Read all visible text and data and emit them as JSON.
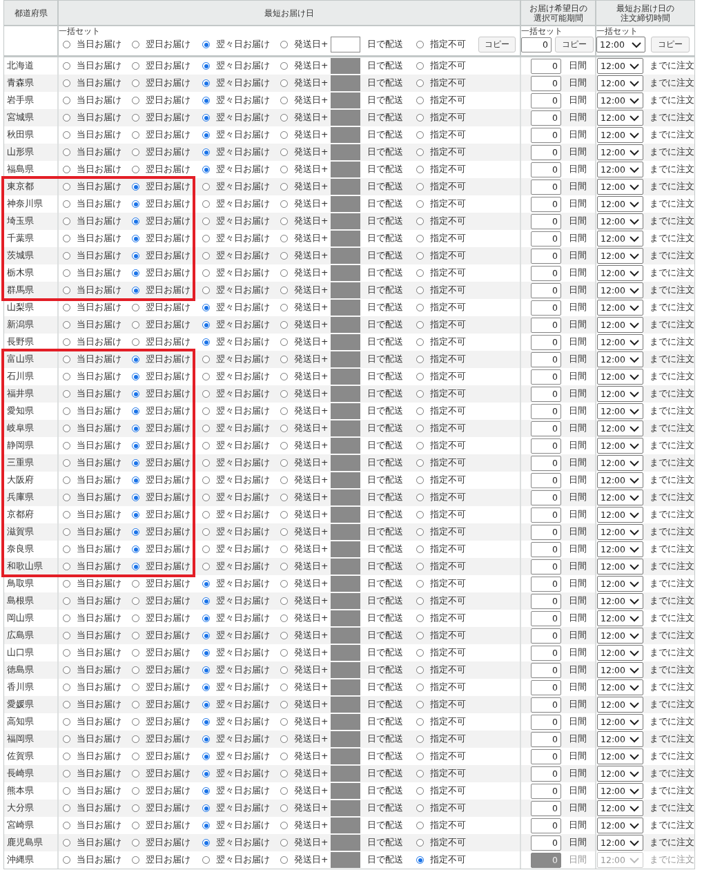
{
  "headers": {
    "prefecture": [
      "都道府県"
    ],
    "earliest": [
      "最短お届け日"
    ],
    "period": [
      "お届け希望日の",
      "選択可能期間"
    ],
    "cutoff": [
      "最短お届け日の",
      "注文締切時間"
    ]
  },
  "bulk": {
    "label": "一括セット",
    "options": [
      {
        "kind": "plain",
        "label": "当日お届け",
        "selected": false
      },
      {
        "kind": "plain",
        "label": "翌日お届け",
        "selected": false
      },
      {
        "kind": "plain",
        "label": "翌々日お届け",
        "selected": true
      },
      {
        "kind": "days",
        "label": "発送日+",
        "suffix": "日で配送",
        "selected": false
      },
      {
        "kind": "plain",
        "label": "指定不可",
        "selected": false
      }
    ],
    "copy": "コピー"
  },
  "period_bulk": {
    "label": "一括セット",
    "value": "0",
    "copy": "コピー"
  },
  "cutoff_bulk": {
    "label": "一括セット",
    "value": "12:00",
    "copy": "コピー"
  },
  "rows": [
    {
      "name": "北海道",
      "marked": false,
      "disabled": false,
      "options": [
        {
          "kind": "plain",
          "label": "当日お届け",
          "selected": false
        },
        {
          "kind": "plain",
          "label": "翌日お届け",
          "selected": false
        },
        {
          "kind": "plain",
          "label": "翌々日お届け",
          "selected": true
        },
        {
          "kind": "days",
          "label": "発送日+",
          "suffix": "日で配送",
          "selected": false
        },
        {
          "kind": "plain",
          "label": "指定不可",
          "selected": false
        }
      ],
      "period": "0",
      "period_unit": "日間",
      "cutoff": "12:00",
      "cutoff_suffix": "までに注文"
    },
    {
      "name": "青森県",
      "marked": false,
      "disabled": false,
      "options": [
        {
          "kind": "plain",
          "label": "当日お届け",
          "selected": false
        },
        {
          "kind": "plain",
          "label": "翌日お届け",
          "selected": false
        },
        {
          "kind": "plain",
          "label": "翌々日お届け",
          "selected": true
        },
        {
          "kind": "days",
          "label": "発送日+",
          "suffix": "日で配送",
          "selected": false
        },
        {
          "kind": "plain",
          "label": "指定不可",
          "selected": false
        }
      ],
      "period": "0",
      "period_unit": "日間",
      "cutoff": "12:00",
      "cutoff_suffix": "までに注文"
    },
    {
      "name": "岩手県",
      "marked": false,
      "disabled": false,
      "options": [
        {
          "kind": "plain",
          "label": "当日お届け",
          "selected": false
        },
        {
          "kind": "plain",
          "label": "翌日お届け",
          "selected": false
        },
        {
          "kind": "plain",
          "label": "翌々日お届け",
          "selected": true
        },
        {
          "kind": "days",
          "label": "発送日+",
          "suffix": "日で配送",
          "selected": false
        },
        {
          "kind": "plain",
          "label": "指定不可",
          "selected": false
        }
      ],
      "period": "0",
      "period_unit": "日間",
      "cutoff": "12:00",
      "cutoff_suffix": "までに注文"
    },
    {
      "name": "宮城県",
      "marked": false,
      "disabled": false,
      "options": [
        {
          "kind": "plain",
          "label": "当日お届け",
          "selected": false
        },
        {
          "kind": "plain",
          "label": "翌日お届け",
          "selected": false
        },
        {
          "kind": "plain",
          "label": "翌々日お届け",
          "selected": true
        },
        {
          "kind": "days",
          "label": "発送日+",
          "suffix": "日で配送",
          "selected": false
        },
        {
          "kind": "plain",
          "label": "指定不可",
          "selected": false
        }
      ],
      "period": "0",
      "period_unit": "日間",
      "cutoff": "12:00",
      "cutoff_suffix": "までに注文"
    },
    {
      "name": "秋田県",
      "marked": false,
      "disabled": false,
      "options": [
        {
          "kind": "plain",
          "label": "当日お届け",
          "selected": false
        },
        {
          "kind": "plain",
          "label": "翌日お届け",
          "selected": false
        },
        {
          "kind": "plain",
          "label": "翌々日お届け",
          "selected": true
        },
        {
          "kind": "days",
          "label": "発送日+",
          "suffix": "日で配送",
          "selected": false
        },
        {
          "kind": "plain",
          "label": "指定不可",
          "selected": false
        }
      ],
      "period": "0",
      "period_unit": "日間",
      "cutoff": "12:00",
      "cutoff_suffix": "までに注文"
    },
    {
      "name": "山形県",
      "marked": false,
      "disabled": false,
      "options": [
        {
          "kind": "plain",
          "label": "当日お届け",
          "selected": false
        },
        {
          "kind": "plain",
          "label": "翌日お届け",
          "selected": false
        },
        {
          "kind": "plain",
          "label": "翌々日お届け",
          "selected": true
        },
        {
          "kind": "days",
          "label": "発送日+",
          "suffix": "日で配送",
          "selected": false
        },
        {
          "kind": "plain",
          "label": "指定不可",
          "selected": false
        }
      ],
      "period": "0",
      "period_unit": "日間",
      "cutoff": "12:00",
      "cutoff_suffix": "までに注文"
    },
    {
      "name": "福島県",
      "marked": false,
      "disabled": false,
      "options": [
        {
          "kind": "plain",
          "label": "当日お届け",
          "selected": false
        },
        {
          "kind": "plain",
          "label": "翌日お届け",
          "selected": false
        },
        {
          "kind": "plain",
          "label": "翌々日お届け",
          "selected": true
        },
        {
          "kind": "days",
          "label": "発送日+",
          "suffix": "日で配送",
          "selected": false
        },
        {
          "kind": "plain",
          "label": "指定不可",
          "selected": false
        }
      ],
      "period": "0",
      "period_unit": "日間",
      "cutoff": "12:00",
      "cutoff_suffix": "までに注文"
    },
    {
      "name": "東京都",
      "marked": true,
      "disabled": false,
      "options": [
        {
          "kind": "plain",
          "label": "当日お届け",
          "selected": false
        },
        {
          "kind": "plain",
          "label": "翌日お届け",
          "selected": true
        },
        {
          "kind": "plain",
          "label": "翌々日お届け",
          "selected": false
        },
        {
          "kind": "days",
          "label": "発送日+",
          "suffix": "日で配送",
          "selected": false
        },
        {
          "kind": "plain",
          "label": "指定不可",
          "selected": false
        }
      ],
      "period": "0",
      "period_unit": "日間",
      "cutoff": "12:00",
      "cutoff_suffix": "までに注文"
    },
    {
      "name": "神奈川県",
      "marked": true,
      "disabled": false,
      "options": [
        {
          "kind": "plain",
          "label": "当日お届け",
          "selected": false
        },
        {
          "kind": "plain",
          "label": "翌日お届け",
          "selected": true
        },
        {
          "kind": "plain",
          "label": "翌々日お届け",
          "selected": false
        },
        {
          "kind": "days",
          "label": "発送日+",
          "suffix": "日で配送",
          "selected": false
        },
        {
          "kind": "plain",
          "label": "指定不可",
          "selected": false
        }
      ],
      "period": "0",
      "period_unit": "日間",
      "cutoff": "12:00",
      "cutoff_suffix": "までに注文"
    },
    {
      "name": "埼玉県",
      "marked": true,
      "disabled": false,
      "options": [
        {
          "kind": "plain",
          "label": "当日お届け",
          "selected": false
        },
        {
          "kind": "plain",
          "label": "翌日お届け",
          "selected": true
        },
        {
          "kind": "plain",
          "label": "翌々日お届け",
          "selected": false
        },
        {
          "kind": "days",
          "label": "発送日+",
          "suffix": "日で配送",
          "selected": false
        },
        {
          "kind": "plain",
          "label": "指定不可",
          "selected": false
        }
      ],
      "period": "0",
      "period_unit": "日間",
      "cutoff": "12:00",
      "cutoff_suffix": "までに注文"
    },
    {
      "name": "千葉県",
      "marked": true,
      "disabled": false,
      "options": [
        {
          "kind": "plain",
          "label": "当日お届け",
          "selected": false
        },
        {
          "kind": "plain",
          "label": "翌日お届け",
          "selected": true
        },
        {
          "kind": "plain",
          "label": "翌々日お届け",
          "selected": false
        },
        {
          "kind": "days",
          "label": "発送日+",
          "suffix": "日で配送",
          "selected": false
        },
        {
          "kind": "plain",
          "label": "指定不可",
          "selected": false
        }
      ],
      "period": "0",
      "period_unit": "日間",
      "cutoff": "12:00",
      "cutoff_suffix": "までに注文"
    },
    {
      "name": "茨城県",
      "marked": true,
      "disabled": false,
      "options": [
        {
          "kind": "plain",
          "label": "当日お届け",
          "selected": false
        },
        {
          "kind": "plain",
          "label": "翌日お届け",
          "selected": true
        },
        {
          "kind": "plain",
          "label": "翌々日お届け",
          "selected": false
        },
        {
          "kind": "days",
          "label": "発送日+",
          "suffix": "日で配送",
          "selected": false
        },
        {
          "kind": "plain",
          "label": "指定不可",
          "selected": false
        }
      ],
      "period": "0",
      "period_unit": "日間",
      "cutoff": "12:00",
      "cutoff_suffix": "までに注文"
    },
    {
      "name": "栃木県",
      "marked": true,
      "disabled": false,
      "options": [
        {
          "kind": "plain",
          "label": "当日お届け",
          "selected": false
        },
        {
          "kind": "plain",
          "label": "翌日お届け",
          "selected": true
        },
        {
          "kind": "plain",
          "label": "翌々日お届け",
          "selected": false
        },
        {
          "kind": "days",
          "label": "発送日+",
          "suffix": "日で配送",
          "selected": false
        },
        {
          "kind": "plain",
          "label": "指定不可",
          "selected": false
        }
      ],
      "period": "0",
      "period_unit": "日間",
      "cutoff": "12:00",
      "cutoff_suffix": "までに注文"
    },
    {
      "name": "群馬県",
      "marked": true,
      "disabled": false,
      "options": [
        {
          "kind": "plain",
          "label": "当日お届け",
          "selected": false
        },
        {
          "kind": "plain",
          "label": "翌日お届け",
          "selected": true
        },
        {
          "kind": "plain",
          "label": "翌々日お届け",
          "selected": false
        },
        {
          "kind": "days",
          "label": "発送日+",
          "suffix": "日で配送",
          "selected": false
        },
        {
          "kind": "plain",
          "label": "指定不可",
          "selected": false
        }
      ],
      "period": "0",
      "period_unit": "日間",
      "cutoff": "12:00",
      "cutoff_suffix": "までに注文"
    },
    {
      "name": "山梨県",
      "marked": false,
      "disabled": false,
      "options": [
        {
          "kind": "plain",
          "label": "当日お届け",
          "selected": false
        },
        {
          "kind": "plain",
          "label": "翌日お届け",
          "selected": false
        },
        {
          "kind": "plain",
          "label": "翌々日お届け",
          "selected": true
        },
        {
          "kind": "days",
          "label": "発送日+",
          "suffix": "日で配送",
          "selected": false
        },
        {
          "kind": "plain",
          "label": "指定不可",
          "selected": false
        }
      ],
      "period": "0",
      "period_unit": "日間",
      "cutoff": "12:00",
      "cutoff_suffix": "までに注文"
    },
    {
      "name": "新潟県",
      "marked": false,
      "disabled": false,
      "options": [
        {
          "kind": "plain",
          "label": "当日お届け",
          "selected": false
        },
        {
          "kind": "plain",
          "label": "翌日お届け",
          "selected": false
        },
        {
          "kind": "plain",
          "label": "翌々日お届け",
          "selected": true
        },
        {
          "kind": "days",
          "label": "発送日+",
          "suffix": "日で配送",
          "selected": false
        },
        {
          "kind": "plain",
          "label": "指定不可",
          "selected": false
        }
      ],
      "period": "0",
      "period_unit": "日間",
      "cutoff": "12:00",
      "cutoff_suffix": "までに注文"
    },
    {
      "name": "長野県",
      "marked": false,
      "disabled": false,
      "options": [
        {
          "kind": "plain",
          "label": "当日お届け",
          "selected": false
        },
        {
          "kind": "plain",
          "label": "翌日お届け",
          "selected": false
        },
        {
          "kind": "plain",
          "label": "翌々日お届け",
          "selected": true
        },
        {
          "kind": "days",
          "label": "発送日+",
          "suffix": "日で配送",
          "selected": false
        },
        {
          "kind": "plain",
          "label": "指定不可",
          "selected": false
        }
      ],
      "period": "0",
      "period_unit": "日間",
      "cutoff": "12:00",
      "cutoff_suffix": "までに注文"
    },
    {
      "name": "富山県",
      "marked": true,
      "disabled": false,
      "options": [
        {
          "kind": "plain",
          "label": "当日お届け",
          "selected": false
        },
        {
          "kind": "plain",
          "label": "翌日お届け",
          "selected": true
        },
        {
          "kind": "plain",
          "label": "翌々日お届け",
          "selected": false
        },
        {
          "kind": "days",
          "label": "発送日+",
          "suffix": "日で配送",
          "selected": false
        },
        {
          "kind": "plain",
          "label": "指定不可",
          "selected": false
        }
      ],
      "period": "0",
      "period_unit": "日間",
      "cutoff": "12:00",
      "cutoff_suffix": "までに注文"
    },
    {
      "name": "石川県",
      "marked": true,
      "disabled": false,
      "options": [
        {
          "kind": "plain",
          "label": "当日お届け",
          "selected": false
        },
        {
          "kind": "plain",
          "label": "翌日お届け",
          "selected": true
        },
        {
          "kind": "plain",
          "label": "翌々日お届け",
          "selected": false
        },
        {
          "kind": "days",
          "label": "発送日+",
          "suffix": "日で配送",
          "selected": false
        },
        {
          "kind": "plain",
          "label": "指定不可",
          "selected": false
        }
      ],
      "period": "0",
      "period_unit": "日間",
      "cutoff": "12:00",
      "cutoff_suffix": "までに注文"
    },
    {
      "name": "福井県",
      "marked": true,
      "disabled": false,
      "options": [
        {
          "kind": "plain",
          "label": "当日お届け",
          "selected": false
        },
        {
          "kind": "plain",
          "label": "翌日お届け",
          "selected": true
        },
        {
          "kind": "plain",
          "label": "翌々日お届け",
          "selected": false
        },
        {
          "kind": "days",
          "label": "発送日+",
          "suffix": "日で配送",
          "selected": false
        },
        {
          "kind": "plain",
          "label": "指定不可",
          "selected": false
        }
      ],
      "period": "0",
      "period_unit": "日間",
      "cutoff": "12:00",
      "cutoff_suffix": "までに注文"
    },
    {
      "name": "愛知県",
      "marked": true,
      "disabled": false,
      "options": [
        {
          "kind": "plain",
          "label": "当日お届け",
          "selected": false
        },
        {
          "kind": "plain",
          "label": "翌日お届け",
          "selected": true
        },
        {
          "kind": "plain",
          "label": "翌々日お届け",
          "selected": false
        },
        {
          "kind": "days",
          "label": "発送日+",
          "suffix": "日で配送",
          "selected": false
        },
        {
          "kind": "plain",
          "label": "指定不可",
          "selected": false
        }
      ],
      "period": "0",
      "period_unit": "日間",
      "cutoff": "12:00",
      "cutoff_suffix": "までに注文"
    },
    {
      "name": "岐阜県",
      "marked": true,
      "disabled": false,
      "options": [
        {
          "kind": "plain",
          "label": "当日お届け",
          "selected": false
        },
        {
          "kind": "plain",
          "label": "翌日お届け",
          "selected": true
        },
        {
          "kind": "plain",
          "label": "翌々日お届け",
          "selected": false
        },
        {
          "kind": "days",
          "label": "発送日+",
          "suffix": "日で配送",
          "selected": false
        },
        {
          "kind": "plain",
          "label": "指定不可",
          "selected": false
        }
      ],
      "period": "0",
      "period_unit": "日間",
      "cutoff": "12:00",
      "cutoff_suffix": "までに注文"
    },
    {
      "name": "静岡県",
      "marked": true,
      "disabled": false,
      "options": [
        {
          "kind": "plain",
          "label": "当日お届け",
          "selected": false
        },
        {
          "kind": "plain",
          "label": "翌日お届け",
          "selected": true
        },
        {
          "kind": "plain",
          "label": "翌々日お届け",
          "selected": false
        },
        {
          "kind": "days",
          "label": "発送日+",
          "suffix": "日で配送",
          "selected": false
        },
        {
          "kind": "plain",
          "label": "指定不可",
          "selected": false
        }
      ],
      "period": "0",
      "period_unit": "日間",
      "cutoff": "12:00",
      "cutoff_suffix": "までに注文"
    },
    {
      "name": "三重県",
      "marked": true,
      "disabled": false,
      "options": [
        {
          "kind": "plain",
          "label": "当日お届け",
          "selected": false
        },
        {
          "kind": "plain",
          "label": "翌日お届け",
          "selected": true
        },
        {
          "kind": "plain",
          "label": "翌々日お届け",
          "selected": false
        },
        {
          "kind": "days",
          "label": "発送日+",
          "suffix": "日で配送",
          "selected": false
        },
        {
          "kind": "plain",
          "label": "指定不可",
          "selected": false
        }
      ],
      "period": "0",
      "period_unit": "日間",
      "cutoff": "12:00",
      "cutoff_suffix": "までに注文"
    },
    {
      "name": "大阪府",
      "marked": true,
      "disabled": false,
      "options": [
        {
          "kind": "plain",
          "label": "当日お届け",
          "selected": false
        },
        {
          "kind": "plain",
          "label": "翌日お届け",
          "selected": true
        },
        {
          "kind": "plain",
          "label": "翌々日お届け",
          "selected": false
        },
        {
          "kind": "days",
          "label": "発送日+",
          "suffix": "日で配送",
          "selected": false
        },
        {
          "kind": "plain",
          "label": "指定不可",
          "selected": false
        }
      ],
      "period": "0",
      "period_unit": "日間",
      "cutoff": "12:00",
      "cutoff_suffix": "までに注文"
    },
    {
      "name": "兵庫県",
      "marked": true,
      "disabled": false,
      "options": [
        {
          "kind": "plain",
          "label": "当日お届け",
          "selected": false
        },
        {
          "kind": "plain",
          "label": "翌日お届け",
          "selected": true
        },
        {
          "kind": "plain",
          "label": "翌々日お届け",
          "selected": false
        },
        {
          "kind": "days",
          "label": "発送日+",
          "suffix": "日で配送",
          "selected": false
        },
        {
          "kind": "plain",
          "label": "指定不可",
          "selected": false
        }
      ],
      "period": "0",
      "period_unit": "日間",
      "cutoff": "12:00",
      "cutoff_suffix": "までに注文"
    },
    {
      "name": "京都府",
      "marked": true,
      "disabled": false,
      "options": [
        {
          "kind": "plain",
          "label": "当日お届け",
          "selected": false
        },
        {
          "kind": "plain",
          "label": "翌日お届け",
          "selected": true
        },
        {
          "kind": "plain",
          "label": "翌々日お届け",
          "selected": false
        },
        {
          "kind": "days",
          "label": "発送日+",
          "suffix": "日で配送",
          "selected": false
        },
        {
          "kind": "plain",
          "label": "指定不可",
          "selected": false
        }
      ],
      "period": "0",
      "period_unit": "日間",
      "cutoff": "12:00",
      "cutoff_suffix": "までに注文"
    },
    {
      "name": "滋賀県",
      "marked": true,
      "disabled": false,
      "options": [
        {
          "kind": "plain",
          "label": "当日お届け",
          "selected": false
        },
        {
          "kind": "plain",
          "label": "翌日お届け",
          "selected": true
        },
        {
          "kind": "plain",
          "label": "翌々日お届け",
          "selected": false
        },
        {
          "kind": "days",
          "label": "発送日+",
          "suffix": "日で配送",
          "selected": false
        },
        {
          "kind": "plain",
          "label": "指定不可",
          "selected": false
        }
      ],
      "period": "0",
      "period_unit": "日間",
      "cutoff": "12:00",
      "cutoff_suffix": "までに注文"
    },
    {
      "name": "奈良県",
      "marked": true,
      "disabled": false,
      "options": [
        {
          "kind": "plain",
          "label": "当日お届け",
          "selected": false
        },
        {
          "kind": "plain",
          "label": "翌日お届け",
          "selected": true
        },
        {
          "kind": "plain",
          "label": "翌々日お届け",
          "selected": false
        },
        {
          "kind": "days",
          "label": "発送日+",
          "suffix": "日で配送",
          "selected": false
        },
        {
          "kind": "plain",
          "label": "指定不可",
          "selected": false
        }
      ],
      "period": "0",
      "period_unit": "日間",
      "cutoff": "12:00",
      "cutoff_suffix": "までに注文"
    },
    {
      "name": "和歌山県",
      "marked": true,
      "disabled": false,
      "options": [
        {
          "kind": "plain",
          "label": "当日お届け",
          "selected": false
        },
        {
          "kind": "plain",
          "label": "翌日お届け",
          "selected": true
        },
        {
          "kind": "plain",
          "label": "翌々日お届け",
          "selected": false
        },
        {
          "kind": "days",
          "label": "発送日+",
          "suffix": "日で配送",
          "selected": false
        },
        {
          "kind": "plain",
          "label": "指定不可",
          "selected": false
        }
      ],
      "period": "0",
      "period_unit": "日間",
      "cutoff": "12:00",
      "cutoff_suffix": "までに注文"
    },
    {
      "name": "鳥取県",
      "marked": false,
      "disabled": false,
      "options": [
        {
          "kind": "plain",
          "label": "当日お届け",
          "selected": false
        },
        {
          "kind": "plain",
          "label": "翌日お届け",
          "selected": false
        },
        {
          "kind": "plain",
          "label": "翌々日お届け",
          "selected": true
        },
        {
          "kind": "days",
          "label": "発送日+",
          "suffix": "日で配送",
          "selected": false
        },
        {
          "kind": "plain",
          "label": "指定不可",
          "selected": false
        }
      ],
      "period": "0",
      "period_unit": "日間",
      "cutoff": "12:00",
      "cutoff_suffix": "までに注文"
    },
    {
      "name": "島根県",
      "marked": false,
      "disabled": false,
      "options": [
        {
          "kind": "plain",
          "label": "当日お届け",
          "selected": false
        },
        {
          "kind": "plain",
          "label": "翌日お届け",
          "selected": false
        },
        {
          "kind": "plain",
          "label": "翌々日お届け",
          "selected": true
        },
        {
          "kind": "days",
          "label": "発送日+",
          "suffix": "日で配送",
          "selected": false
        },
        {
          "kind": "plain",
          "label": "指定不可",
          "selected": false
        }
      ],
      "period": "0",
      "period_unit": "日間",
      "cutoff": "12:00",
      "cutoff_suffix": "までに注文"
    },
    {
      "name": "岡山県",
      "marked": false,
      "disabled": false,
      "options": [
        {
          "kind": "plain",
          "label": "当日お届け",
          "selected": false
        },
        {
          "kind": "plain",
          "label": "翌日お届け",
          "selected": false
        },
        {
          "kind": "plain",
          "label": "翌々日お届け",
          "selected": true
        },
        {
          "kind": "days",
          "label": "発送日+",
          "suffix": "日で配送",
          "selected": false
        },
        {
          "kind": "plain",
          "label": "指定不可",
          "selected": false
        }
      ],
      "period": "0",
      "period_unit": "日間",
      "cutoff": "12:00",
      "cutoff_suffix": "までに注文"
    },
    {
      "name": "広島県",
      "marked": false,
      "disabled": false,
      "options": [
        {
          "kind": "plain",
          "label": "当日お届け",
          "selected": false
        },
        {
          "kind": "plain",
          "label": "翌日お届け",
          "selected": false
        },
        {
          "kind": "plain",
          "label": "翌々日お届け",
          "selected": true
        },
        {
          "kind": "days",
          "label": "発送日+",
          "suffix": "日で配送",
          "selected": false
        },
        {
          "kind": "plain",
          "label": "指定不可",
          "selected": false
        }
      ],
      "period": "0",
      "period_unit": "日間",
      "cutoff": "12:00",
      "cutoff_suffix": "までに注文"
    },
    {
      "name": "山口県",
      "marked": false,
      "disabled": false,
      "options": [
        {
          "kind": "plain",
          "label": "当日お届け",
          "selected": false
        },
        {
          "kind": "plain",
          "label": "翌日お届け",
          "selected": false
        },
        {
          "kind": "plain",
          "label": "翌々日お届け",
          "selected": true
        },
        {
          "kind": "days",
          "label": "発送日+",
          "suffix": "日で配送",
          "selected": false
        },
        {
          "kind": "plain",
          "label": "指定不可",
          "selected": false
        }
      ],
      "period": "0",
      "period_unit": "日間",
      "cutoff": "12:00",
      "cutoff_suffix": "までに注文"
    },
    {
      "name": "徳島県",
      "marked": false,
      "disabled": false,
      "options": [
        {
          "kind": "plain",
          "label": "当日お届け",
          "selected": false
        },
        {
          "kind": "plain",
          "label": "翌日お届け",
          "selected": false
        },
        {
          "kind": "plain",
          "label": "翌々日お届け",
          "selected": true
        },
        {
          "kind": "days",
          "label": "発送日+",
          "suffix": "日で配送",
          "selected": false
        },
        {
          "kind": "plain",
          "label": "指定不可",
          "selected": false
        }
      ],
      "period": "0",
      "period_unit": "日間",
      "cutoff": "12:00",
      "cutoff_suffix": "までに注文"
    },
    {
      "name": "香川県",
      "marked": false,
      "disabled": false,
      "options": [
        {
          "kind": "plain",
          "label": "当日お届け",
          "selected": false
        },
        {
          "kind": "plain",
          "label": "翌日お届け",
          "selected": false
        },
        {
          "kind": "plain",
          "label": "翌々日お届け",
          "selected": true
        },
        {
          "kind": "days",
          "label": "発送日+",
          "suffix": "日で配送",
          "selected": false
        },
        {
          "kind": "plain",
          "label": "指定不可",
          "selected": false
        }
      ],
      "period": "0",
      "period_unit": "日間",
      "cutoff": "12:00",
      "cutoff_suffix": "までに注文"
    },
    {
      "name": "愛媛県",
      "marked": false,
      "disabled": false,
      "options": [
        {
          "kind": "plain",
          "label": "当日お届け",
          "selected": false
        },
        {
          "kind": "plain",
          "label": "翌日お届け",
          "selected": false
        },
        {
          "kind": "plain",
          "label": "翌々日お届け",
          "selected": true
        },
        {
          "kind": "days",
          "label": "発送日+",
          "suffix": "日で配送",
          "selected": false
        },
        {
          "kind": "plain",
          "label": "指定不可",
          "selected": false
        }
      ],
      "period": "0",
      "period_unit": "日間",
      "cutoff": "12:00",
      "cutoff_suffix": "までに注文"
    },
    {
      "name": "高知県",
      "marked": false,
      "disabled": false,
      "options": [
        {
          "kind": "plain",
          "label": "当日お届け",
          "selected": false
        },
        {
          "kind": "plain",
          "label": "翌日お届け",
          "selected": false
        },
        {
          "kind": "plain",
          "label": "翌々日お届け",
          "selected": true
        },
        {
          "kind": "days",
          "label": "発送日+",
          "suffix": "日で配送",
          "selected": false
        },
        {
          "kind": "plain",
          "label": "指定不可",
          "selected": false
        }
      ],
      "period": "0",
      "period_unit": "日間",
      "cutoff": "12:00",
      "cutoff_suffix": "までに注文"
    },
    {
      "name": "福岡県",
      "marked": false,
      "disabled": false,
      "options": [
        {
          "kind": "plain",
          "label": "当日お届け",
          "selected": false
        },
        {
          "kind": "plain",
          "label": "翌日お届け",
          "selected": false
        },
        {
          "kind": "plain",
          "label": "翌々日お届け",
          "selected": true
        },
        {
          "kind": "days",
          "label": "発送日+",
          "suffix": "日で配送",
          "selected": false
        },
        {
          "kind": "plain",
          "label": "指定不可",
          "selected": false
        }
      ],
      "period": "0",
      "period_unit": "日間",
      "cutoff": "12:00",
      "cutoff_suffix": "までに注文"
    },
    {
      "name": "佐賀県",
      "marked": false,
      "disabled": false,
      "options": [
        {
          "kind": "plain",
          "label": "当日お届け",
          "selected": false
        },
        {
          "kind": "plain",
          "label": "翌日お届け",
          "selected": false
        },
        {
          "kind": "plain",
          "label": "翌々日お届け",
          "selected": true
        },
        {
          "kind": "days",
          "label": "発送日+",
          "suffix": "日で配送",
          "selected": false
        },
        {
          "kind": "plain",
          "label": "指定不可",
          "selected": false
        }
      ],
      "period": "0",
      "period_unit": "日間",
      "cutoff": "12:00",
      "cutoff_suffix": "までに注文"
    },
    {
      "name": "長崎県",
      "marked": false,
      "disabled": false,
      "options": [
        {
          "kind": "plain",
          "label": "当日お届け",
          "selected": false
        },
        {
          "kind": "plain",
          "label": "翌日お届け",
          "selected": false
        },
        {
          "kind": "plain",
          "label": "翌々日お届け",
          "selected": true
        },
        {
          "kind": "days",
          "label": "発送日+",
          "suffix": "日で配送",
          "selected": false
        },
        {
          "kind": "plain",
          "label": "指定不可",
          "selected": false
        }
      ],
      "period": "0",
      "period_unit": "日間",
      "cutoff": "12:00",
      "cutoff_suffix": "までに注文"
    },
    {
      "name": "熊本県",
      "marked": false,
      "disabled": false,
      "options": [
        {
          "kind": "plain",
          "label": "当日お届け",
          "selected": false
        },
        {
          "kind": "plain",
          "label": "翌日お届け",
          "selected": false
        },
        {
          "kind": "plain",
          "label": "翌々日お届け",
          "selected": true
        },
        {
          "kind": "days",
          "label": "発送日+",
          "suffix": "日で配送",
          "selected": false
        },
        {
          "kind": "plain",
          "label": "指定不可",
          "selected": false
        }
      ],
      "period": "0",
      "period_unit": "日間",
      "cutoff": "12:00",
      "cutoff_suffix": "までに注文"
    },
    {
      "name": "大分県",
      "marked": false,
      "disabled": false,
      "options": [
        {
          "kind": "plain",
          "label": "当日お届け",
          "selected": false
        },
        {
          "kind": "plain",
          "label": "翌日お届け",
          "selected": false
        },
        {
          "kind": "plain",
          "label": "翌々日お届け",
          "selected": true
        },
        {
          "kind": "days",
          "label": "発送日+",
          "suffix": "日で配送",
          "selected": false
        },
        {
          "kind": "plain",
          "label": "指定不可",
          "selected": false
        }
      ],
      "period": "0",
      "period_unit": "日間",
      "cutoff": "12:00",
      "cutoff_suffix": "までに注文"
    },
    {
      "name": "宮崎県",
      "marked": false,
      "disabled": false,
      "options": [
        {
          "kind": "plain",
          "label": "当日お届け",
          "selected": false
        },
        {
          "kind": "plain",
          "label": "翌日お届け",
          "selected": false
        },
        {
          "kind": "plain",
          "label": "翌々日お届け",
          "selected": true
        },
        {
          "kind": "days",
          "label": "発送日+",
          "suffix": "日で配送",
          "selected": false
        },
        {
          "kind": "plain",
          "label": "指定不可",
          "selected": false
        }
      ],
      "period": "0",
      "period_unit": "日間",
      "cutoff": "12:00",
      "cutoff_suffix": "までに注文"
    },
    {
      "name": "鹿児島県",
      "marked": false,
      "disabled": false,
      "options": [
        {
          "kind": "plain",
          "label": "当日お届け",
          "selected": false
        },
        {
          "kind": "plain",
          "label": "翌日お届け",
          "selected": false
        },
        {
          "kind": "plain",
          "label": "翌々日お届け",
          "selected": true
        },
        {
          "kind": "days",
          "label": "発送日+",
          "suffix": "日で配送",
          "selected": false
        },
        {
          "kind": "plain",
          "label": "指定不可",
          "selected": false
        }
      ],
      "period": "0",
      "period_unit": "日間",
      "cutoff": "12:00",
      "cutoff_suffix": "までに注文"
    },
    {
      "name": "沖縄県",
      "marked": false,
      "disabled": true,
      "options": [
        {
          "kind": "plain",
          "label": "当日お届け",
          "selected": false
        },
        {
          "kind": "plain",
          "label": "翌日お届け",
          "selected": false
        },
        {
          "kind": "plain",
          "label": "翌々日お届け",
          "selected": false
        },
        {
          "kind": "days",
          "label": "発送日+",
          "suffix": "日で配送",
          "selected": false
        },
        {
          "kind": "plain",
          "label": "指定不可",
          "selected": true
        }
      ],
      "period": "0",
      "period_unit": "日間",
      "cutoff": "12:00",
      "cutoff_suffix": "までに注文"
    }
  ]
}
